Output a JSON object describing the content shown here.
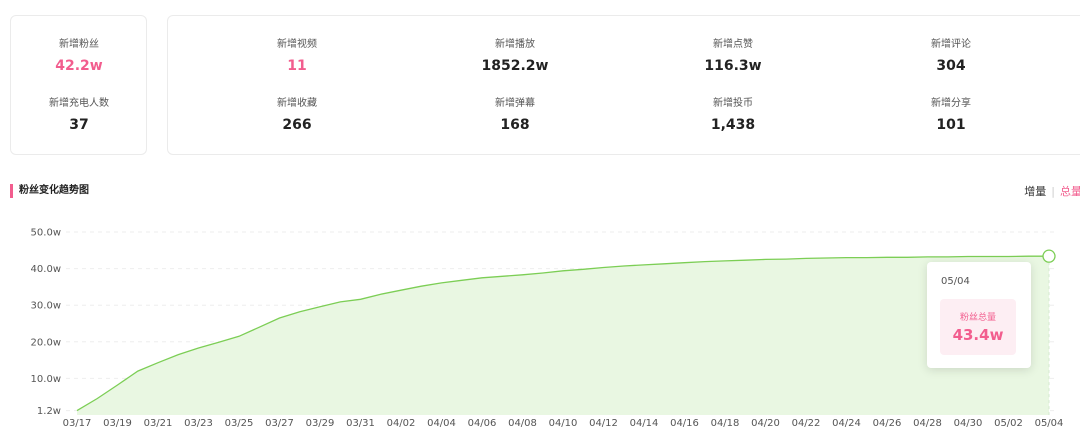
{
  "stats_left": [
    {
      "label": "新增粉丝",
      "value": "42.2w",
      "highlight": true
    },
    {
      "label": "新增充电人数",
      "value": "37",
      "highlight": false
    }
  ],
  "stats_grid": [
    {
      "label": "新增视频",
      "value": "11",
      "highlight": true
    },
    {
      "label": "新增播放",
      "value": "1852.2w",
      "highlight": false
    },
    {
      "label": "新增点赞",
      "value": "116.3w",
      "highlight": false
    },
    {
      "label": "新增评论",
      "value": "304",
      "highlight": false
    },
    {
      "label": "新增收藏",
      "value": "266",
      "highlight": false
    },
    {
      "label": "新增弹幕",
      "value": "168",
      "highlight": false
    },
    {
      "label": "新增投币",
      "value": "1,438",
      "highlight": false
    },
    {
      "label": "新增分享",
      "value": "101",
      "highlight": false
    }
  ],
  "section": {
    "title": "粉丝变化趋势图",
    "toggle_increment": "增量",
    "toggle_separator": "|",
    "toggle_total": "总量"
  },
  "tooltip": {
    "date": "05/04",
    "label": "粉丝总量",
    "value": "43.4w"
  },
  "colors": {
    "accent": "#f25d8e",
    "line": "#7cce55",
    "fill": "#e9f7e2"
  },
  "chart_data": {
    "type": "area",
    "x": [
      "03/17",
      "03/18",
      "03/19",
      "03/20",
      "03/21",
      "03/22",
      "03/23",
      "03/24",
      "03/25",
      "03/26",
      "03/27",
      "03/28",
      "03/29",
      "03/30",
      "03/31",
      "04/01",
      "04/02",
      "04/03",
      "04/04",
      "04/05",
      "04/06",
      "04/07",
      "04/08",
      "04/09",
      "04/10",
      "04/11",
      "04/12",
      "04/13",
      "04/14",
      "04/15",
      "04/16",
      "04/17",
      "04/18",
      "04/19",
      "04/20",
      "04/21",
      "04/22",
      "04/23",
      "04/24",
      "04/25",
      "04/26",
      "04/27",
      "04/28",
      "04/29",
      "04/30",
      "05/01",
      "05/02",
      "05/03",
      "05/04"
    ],
    "x_tick_labels": [
      "03/17",
      "03/19",
      "03/21",
      "03/23",
      "03/25",
      "03/27",
      "03/29",
      "03/31",
      "04/02",
      "04/04",
      "04/06",
      "04/08",
      "04/10",
      "04/12",
      "04/14",
      "04/16",
      "04/18",
      "04/20",
      "04/22",
      "04/24",
      "04/26",
      "04/28",
      "04/30",
      "05/02",
      "05/04"
    ],
    "series": [
      {
        "values": [
          1.2,
          4.5,
          8.2,
          12.0,
          14.3,
          16.5,
          18.3,
          19.9,
          21.5,
          24.0,
          26.5,
          28.2,
          29.6,
          30.9,
          31.6,
          33.0,
          34.1,
          35.2,
          36.1,
          36.8,
          37.5,
          37.9,
          38.3,
          38.8,
          39.4,
          39.8,
          40.3,
          40.7,
          41.0,
          41.3,
          41.6,
          41.9,
          42.1,
          42.3,
          42.5,
          42.6,
          42.8,
          42.9,
          43.0,
          43.0,
          43.1,
          43.1,
          43.2,
          43.2,
          43.3,
          43.3,
          43.3,
          43.4,
          43.4
        ]
      }
    ],
    "y_ticks": [
      "1.2w",
      "10.0w",
      "20.0w",
      "30.0w",
      "40.0w",
      "50.0w"
    ],
    "y_tick_values": [
      1.2,
      10,
      20,
      30,
      40,
      50
    ],
    "ylim": [
      0,
      50
    ],
    "grid": true,
    "title": "粉丝变化趋势图"
  }
}
